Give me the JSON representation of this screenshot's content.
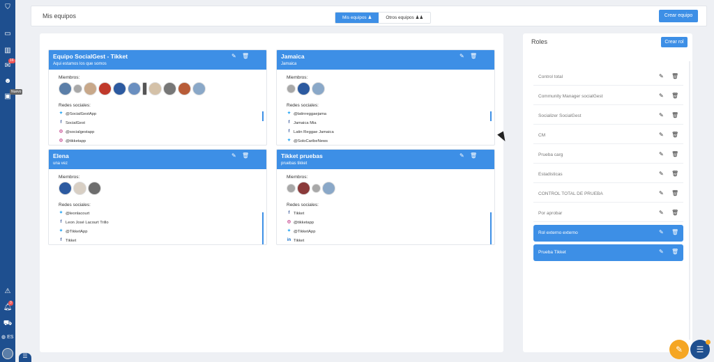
{
  "sidebar": {
    "badges": {
      "messages": "16",
      "notifications": "3"
    },
    "tag": "Nuevo",
    "language": "ES"
  },
  "header": {
    "title": "Mis equipos",
    "tabs": [
      "Mis equipos",
      "Otros equipos"
    ],
    "create_team": "Crear equipo"
  },
  "teams": [
    {
      "name": "Equipo SocialGest - Tikket",
      "subtitle": "Aqui estamos los que somos",
      "members_label": "Miembros:",
      "social_label": "Redes sociales:",
      "networks": [
        {
          "type": "twitter",
          "label": "@SocialGestApp"
        },
        {
          "type": "facebook",
          "label": "SocialGest"
        },
        {
          "type": "instagram",
          "label": "@socialgestapp"
        },
        {
          "type": "instagram",
          "label": "@tikketapp"
        }
      ]
    },
    {
      "name": "Jamaica",
      "subtitle": "Jamaica",
      "members_label": "Miembros:",
      "social_label": "Redes sociales:",
      "networks": [
        {
          "type": "twitter",
          "label": "@latinreggaejama"
        },
        {
          "type": "facebook",
          "label": "Jamaica Mia"
        },
        {
          "type": "facebook",
          "label": "Latin Reggae Jamaica"
        },
        {
          "type": "twitter",
          "label": "@SoloCaribeNews"
        }
      ]
    },
    {
      "name": "Elena",
      "subtitle": "una vez",
      "members_label": "Miembros:",
      "social_label": "Redes sociales:",
      "networks": [
        {
          "type": "twitter",
          "label": "@leonlacourt"
        },
        {
          "type": "facebook",
          "label": "Leon José Lacourt Trillo"
        },
        {
          "type": "twitter",
          "label": "@TikketApp"
        },
        {
          "type": "facebook",
          "label": "Tikket"
        }
      ]
    },
    {
      "name": "Tikket pruebas",
      "subtitle": "pruebas tikket",
      "members_label": "Miembros:",
      "social_label": "Redes sociales:",
      "networks": [
        {
          "type": "facebook",
          "label": "Tikket"
        },
        {
          "type": "instagram",
          "label": "@tikketapp"
        },
        {
          "type": "twitter",
          "label": "@TikketApp"
        },
        {
          "type": "linkedin",
          "label": "Tikket"
        }
      ]
    }
  ],
  "roles": {
    "title": "Roles",
    "create": "Crear rol",
    "items": [
      "Control total",
      "Community Manager socialGest",
      "Socializer SocialGest",
      "CM",
      "Prueba carg",
      "Estadisticas",
      "CONTROL TOTAL DE PRUEBA",
      "Por aprobar",
      "Rol externo externo",
      "Prueba Tikket"
    ]
  }
}
